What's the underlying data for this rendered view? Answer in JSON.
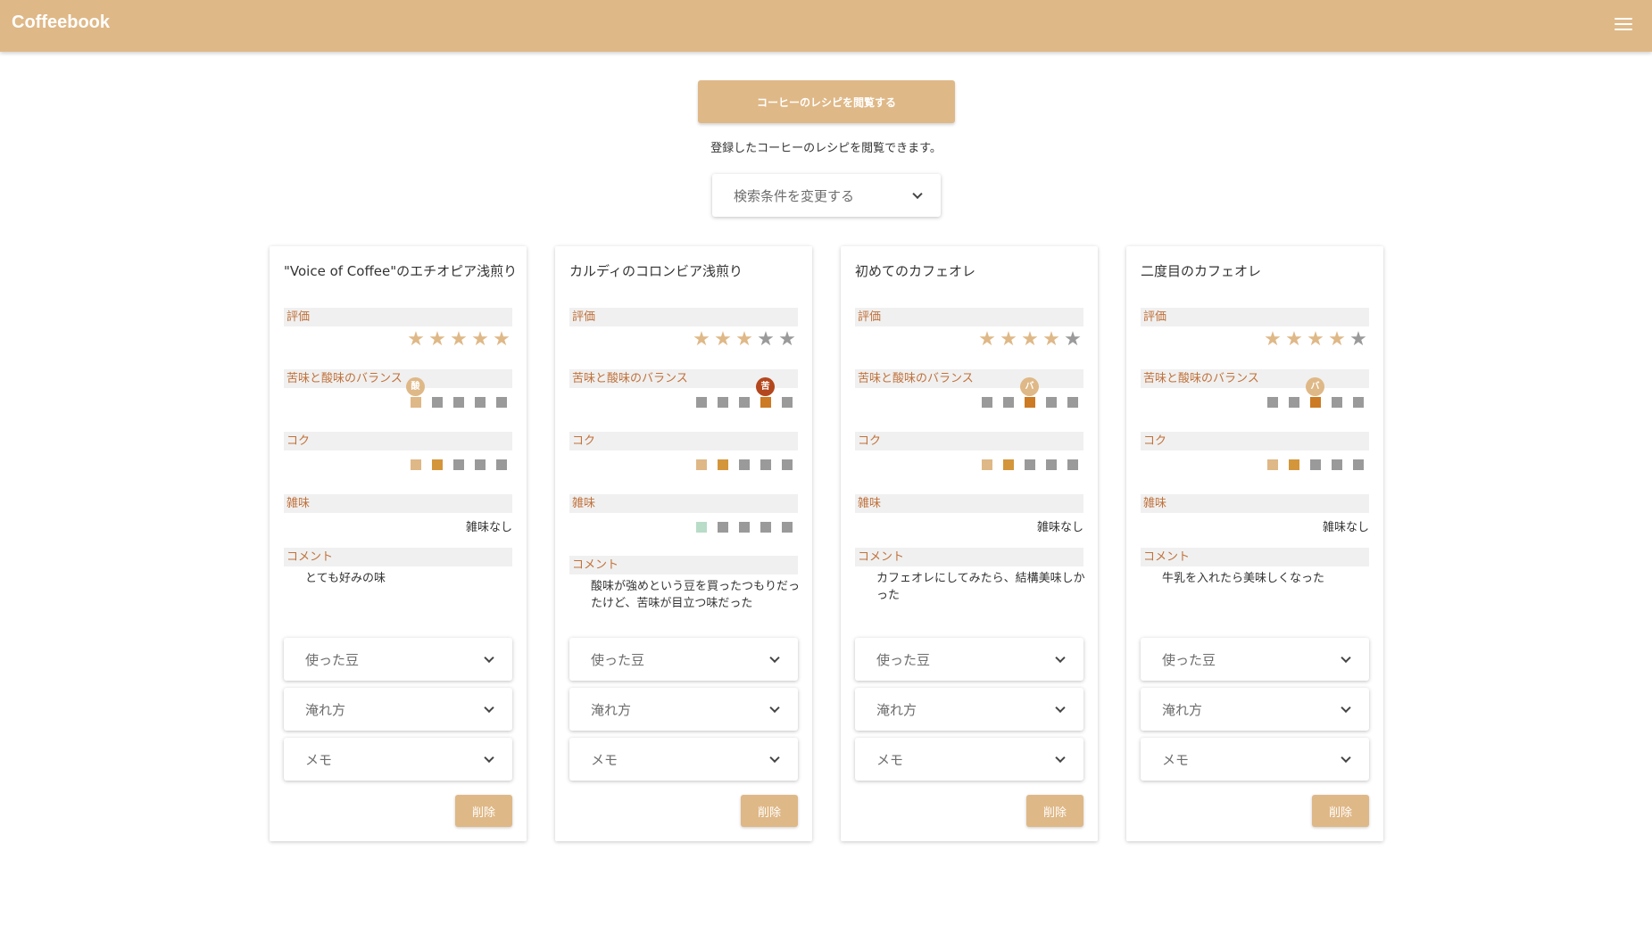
{
  "app": {
    "title": "Coffeebook"
  },
  "header": {
    "menu_icon": "hamburger-menu-icon"
  },
  "main": {
    "view_button": "コーヒーのレシピを閲覧する",
    "subtitle": "登録したコーヒーのレシピを閲覧できます。",
    "search_label": "検索条件を変更する"
  },
  "labels": {
    "rating": "評価",
    "balance": "苦味と酸味のバランス",
    "body": "コク",
    "off_flavor": "雑味",
    "comment": "コメント",
    "beans": "使った豆",
    "brew": "淹れ方",
    "memo": "メモ",
    "delete": "削除"
  },
  "colors": {
    "accent": "#dfb887",
    "label_text": "#c0713a",
    "inactive": "#9a9a9a"
  },
  "cards": [
    {
      "title": "\"Voice of Coffee\"のエチオピア浅煎り",
      "rating": 5,
      "balance": {
        "position": 1,
        "badge": "酸",
        "badge_color": "#dfb887"
      },
      "body": 2,
      "off_flavor": {
        "type": "text",
        "text": "雑味なし"
      },
      "comment": "とても好みの味"
    },
    {
      "title": "カルディのコロンビア浅煎り",
      "rating": 3,
      "balance": {
        "position": 4,
        "badge": "苦",
        "badge_color": "#b3471d"
      },
      "body": 2,
      "off_flavor": {
        "type": "scale",
        "value": 1
      },
      "comment": "酸味が強めという豆を買ったつもりだったけど、苦味が目立つ味だった"
    },
    {
      "title": "初めてのカフェオレ",
      "rating": 4,
      "balance": {
        "position": 3,
        "badge": "バ",
        "badge_color": "#dfb887"
      },
      "body": 2,
      "off_flavor": {
        "type": "text",
        "text": "雑味なし"
      },
      "comment": "カフェオレにしてみたら、結構美味しかった"
    },
    {
      "title": "二度目のカフェオレ",
      "rating": 4,
      "balance": {
        "position": 3,
        "badge": "バ",
        "badge_color": "#dfb887"
      },
      "body": 2,
      "off_flavor": {
        "type": "text",
        "text": "雑味なし"
      },
      "comment": "牛乳を入れたら美味しくなった"
    }
  ]
}
